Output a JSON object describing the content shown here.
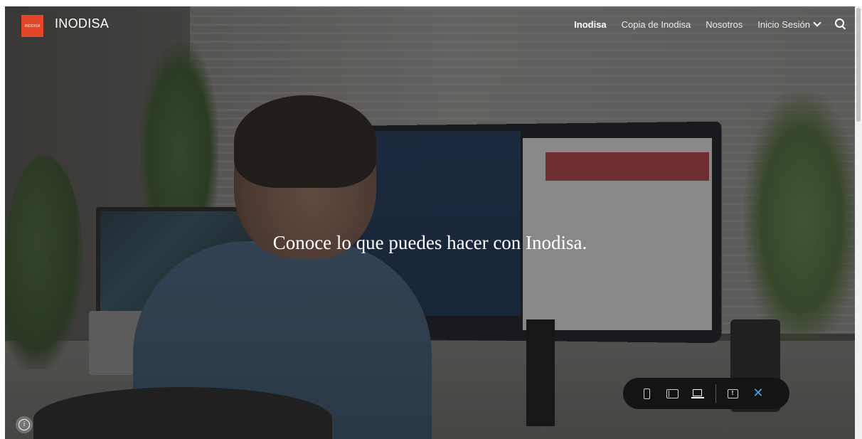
{
  "header": {
    "logo_text": "INODISA",
    "site_title": "INODISA",
    "nav": [
      {
        "label": "Inodisa",
        "active": true
      },
      {
        "label": "Copia de Inodisa",
        "active": false
      },
      {
        "label": "Nosotros",
        "active": false
      },
      {
        "label": "Inicio Sesión",
        "active": false,
        "has_dropdown": true
      }
    ],
    "icons": {
      "search": "search-icon",
      "dropdown": "chevron-down-icon"
    }
  },
  "hero": {
    "heading": "Conoce lo que puedes hacer con Inodisa."
  },
  "preview_toolbar": {
    "icons": [
      "phone-icon",
      "tablet-icon",
      "laptop-icon",
      "feedback-icon",
      "close-icon"
    ],
    "selected": "laptop-icon",
    "close_glyph": "✕",
    "feedback_glyph": "!"
  },
  "info_button": {
    "glyph": "i"
  },
  "colors": {
    "logo_bg": "#e4462a",
    "toolbar_bg": "#141414",
    "close_accent": "#4aa3f0"
  }
}
